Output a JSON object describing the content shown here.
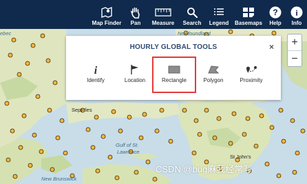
{
  "toolbar": {
    "items": [
      {
        "label": "Map Finder",
        "icon": "map-marker-icon"
      },
      {
        "label": "Pan",
        "icon": "hand-icon"
      },
      {
        "label": "Measure",
        "icon": "ruler-icon"
      },
      {
        "label": "Search",
        "icon": "search-icon"
      },
      {
        "label": "Legend",
        "icon": "list-icon"
      },
      {
        "label": "Basemaps",
        "icon": "grid-icon"
      },
      {
        "label": "Help",
        "icon": "question-icon"
      },
      {
        "label": "Info",
        "icon": "info-icon"
      }
    ]
  },
  "zoom": {
    "in": "+",
    "out": "−"
  },
  "panel": {
    "title": "HOURLY GLOBAL TOOLS",
    "close": "×",
    "tools": [
      {
        "label": "Identify",
        "icon": "info-i-icon"
      },
      {
        "label": "Location",
        "icon": "flag-icon"
      },
      {
        "label": "Rectangle",
        "icon": "rectangle-icon",
        "selected": true
      },
      {
        "label": "Polygon",
        "icon": "polygon-icon"
      },
      {
        "label": "Proximity",
        "icon": "proximity-icon"
      }
    ],
    "highlight_color": "#e33a3a"
  },
  "map": {
    "labels": {
      "quebec": "ebec",
      "newfoundland": "Newfoundland",
      "sept_iles": "Sept-Iles",
      "gulf": "Gulf of St.",
      "lawrence": "Lawrence",
      "st_johns": "St John's",
      "new_brunswick": "New Brunswick"
    }
  },
  "watermark": "CSDN @bug麻我经常写"
}
